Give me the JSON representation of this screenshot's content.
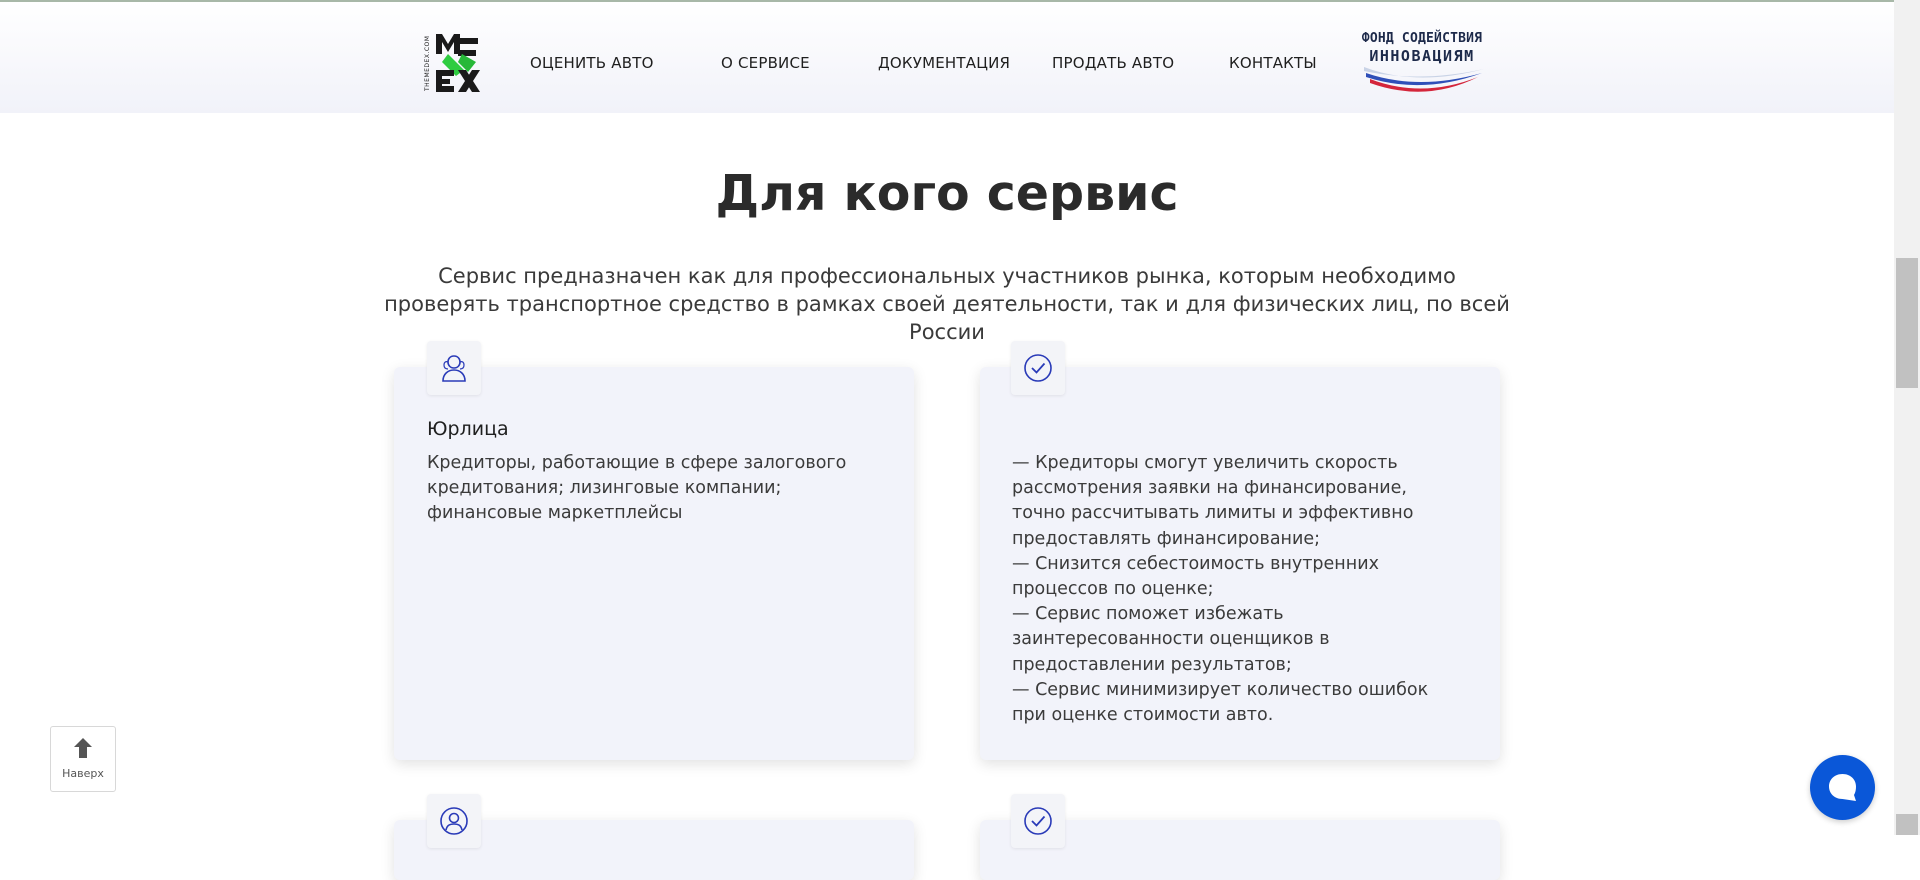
{
  "header": {
    "logo_text": "MEX",
    "logo_side_text": "THEMEDEX.COM",
    "nav": [
      {
        "label": "ОЦЕНИТЬ АВТО"
      },
      {
        "label": "О СЕРВИСЕ"
      },
      {
        "label": "ДОКУМЕНТАЦИЯ"
      },
      {
        "label": "ПРОДАТЬ АВТО"
      },
      {
        "label": "КОНТАКТЫ"
      }
    ],
    "partner_logo": {
      "line1": "ФОНД СОДЕЙСТВИЯ",
      "line2": "ИННОВАЦИЯМ"
    }
  },
  "main": {
    "title": "Для кого сервис",
    "subtitle": "Сервис предназначен как для профессиональных участников рынка, которым необходимо проверять транспортное средство в рамках своей деятельности, так и для физических лиц, по всей России",
    "cards": [
      {
        "icon": "users-icon",
        "title": "Юрлица",
        "text": "Кредиторы, работающие в сфере залогового\nкредитования; лизинговые компании;\nфинансовые маркетплейсы"
      },
      {
        "icon": "check-circle-icon",
        "title": "",
        "text": "— Кредиторы смогут увеличить скорость\nрассмотрения заявки на финансирование,\nточно рассчитывать лимиты и эффективно\nпредоставлять финансирование;\n— Снизится себестоимость внутренних\nпроцессов по оценке;\n— Сервис поможет избежать\nзаинтересованности оценщиков в\nпредоставлении результатов;\n— Сервис минимизирует количество ошибок\nпри оценке стоимости авто."
      },
      {
        "icon": "user-icon"
      },
      {
        "icon": "check-circle-icon"
      }
    ]
  },
  "widgets": {
    "to_top_label": "Наверх",
    "chat_icon": "chat-bubble-icon"
  },
  "colors": {
    "accent_blue": "#0a57d8",
    "icon_blue": "#2a3bb8",
    "logo_green": "#2ecc40",
    "card_bg": "#f2f3fa"
  }
}
